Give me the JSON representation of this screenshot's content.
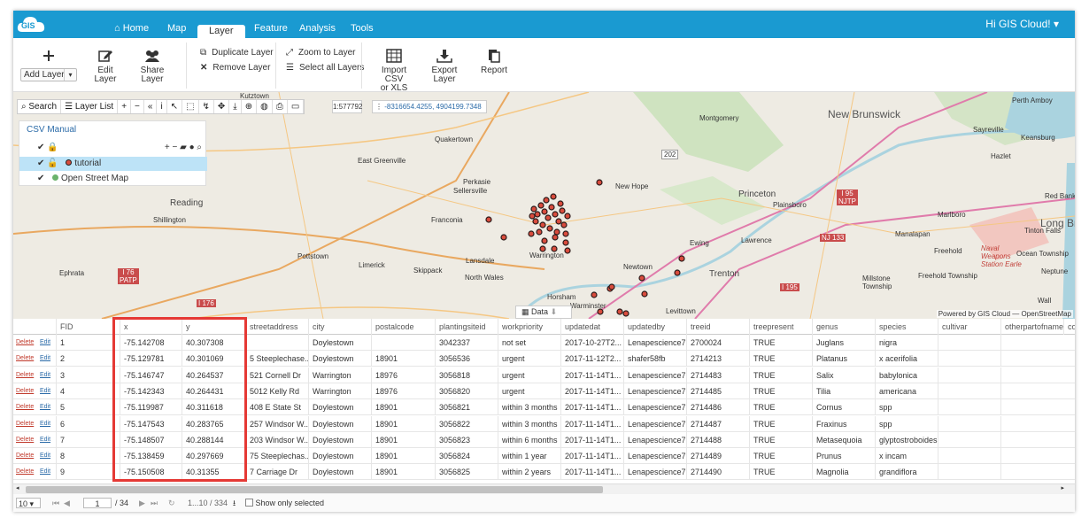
{
  "topnav": {
    "logo_text": "GIS",
    "tabs": [
      "Home",
      "Map",
      "Layer",
      "Feature",
      "Analysis",
      "Tools"
    ],
    "active_tab": "Layer",
    "user": "Hi GIS Cloud! ▾"
  },
  "ribbon": {
    "add_layer": "Add Layer",
    "edit_layer": "Edit Layer",
    "share_layer": "Share Layer",
    "duplicate_layer": "Duplicate Layer",
    "remove_layer": "Remove Layer",
    "zoom_to_layer": "Zoom to Layer",
    "select_all_layers": "Select all Layers",
    "import_csv_1": "Import CSV",
    "import_csv_2": "or XLS",
    "export_layer_1": "Export",
    "export_layer_2": "Layer",
    "report": "Report"
  },
  "map": {
    "search": "Search",
    "layer_list": "Layer List",
    "scale": "1:577792",
    "coords": "-8316654.4255, 4904199.7348",
    "panel_title": "CSV Manual",
    "layers": [
      "tutorial",
      "Open Street Map"
    ],
    "data_tab": "Data",
    "attribution": "Powered by GIS Cloud — OpenStreetMap",
    "labels": {
      "kutztown": "Kutztown",
      "montgomery": "Montgomery",
      "new_brunswick": "New Brunswick",
      "perth_amboy": "Perth Amboy",
      "sayreville": "Sayreville",
      "quakertown": "Quakertown",
      "east_greenville": "East Greenville",
      "keansburg": "Keansburg",
      "perkasie": "Perkasie",
      "sellersville": "Sellersville",
      "new_hope": "New Hope",
      "hazlet": "Hazlet",
      "reading": "Reading",
      "shillington": "Shillington",
      "franconia": "Franconia",
      "princeton": "Princeton",
      "plainsboro": "Plainsboro",
      "red_bank": "Red Bank",
      "long_branch": "Long Branch",
      "marlboro": "Marlboro",
      "manalapan": "Manalapan",
      "tinton_falls": "Tinton Falls",
      "ewing": "Ewing",
      "lawrence": "Lawrence",
      "freehold": "Freehold",
      "lansdale": "Lansdale",
      "warrington": "Warrington",
      "pottstown": "Pottstown",
      "limerick": "Limerick",
      "skippack": "Skippack",
      "north_wales": "North Wales",
      "newtown": "Newtown",
      "trenton": "Trenton",
      "ocean_township": "Ocean Township",
      "neptune": "Neptune",
      "freehold_township": "Freehold Township",
      "millstone": "Millstone Township",
      "naval": "Naval Weapons Station Earle",
      "ephrata": "Ephrata",
      "horsham": "Horsham",
      "warminster": "Warminster",
      "levittown": "Levittown",
      "wall": "Wall",
      "i202": "202",
      "i95": "I 95",
      "njtp": "NJTP",
      "nj133": "NJ 133",
      "i176a": "I 76",
      "patp": "PATP",
      "i176b": "I 176",
      "i195": "I 195"
    }
  },
  "table": {
    "columns": [
      "FID",
      "x",
      "y",
      "streetaddress",
      "city",
      "postalcode",
      "plantingsiteid",
      "workpriority",
      "updatedat",
      "updatedby",
      "treeid",
      "treepresent",
      "genus",
      "species",
      "cultivar",
      "otherpartofname",
      "co"
    ],
    "delete_label": "Delete",
    "edit_label": "Edit",
    "rows": [
      [
        "1",
        "-75.142708",
        "40.307308",
        "",
        "Doylestown",
        "",
        "3042337",
        "not set",
        "2017-10-27T2...",
        "Lenapescience7",
        "2700024",
        "TRUE",
        "Juglans",
        "nigra",
        "",
        ""
      ],
      [
        "2",
        "-75.129781",
        "40.301069",
        "5 Steeplechase...",
        "Doylestown",
        "18901",
        "3056536",
        "urgent",
        "2017-11-12T2...",
        "shafer58fb",
        "2714213",
        "TRUE",
        "Platanus",
        "x acerifolia",
        "",
        ""
      ],
      [
        "3",
        "-75.146747",
        "40.264537",
        "521 Cornell Dr",
        "Warrington",
        "18976",
        "3056818",
        "urgent",
        "2017-11-14T1...",
        "Lenapescience7",
        "2714483",
        "TRUE",
        "Salix",
        "babylonica",
        "",
        ""
      ],
      [
        "4",
        "-75.142343",
        "40.264431",
        "5012 Kelly Rd",
        "Warrington",
        "18976",
        "3056820",
        "urgent",
        "2017-11-14T1...",
        "Lenapescience7",
        "2714485",
        "TRUE",
        "Tilia",
        "americana",
        "",
        ""
      ],
      [
        "5",
        "-75.119987",
        "40.311618",
        "408 E State St",
        "Doylestown",
        "18901",
        "3056821",
        "within 3 months",
        "2017-11-14T1...",
        "Lenapescience7",
        "2714486",
        "TRUE",
        "Cornus",
        "spp",
        "",
        ""
      ],
      [
        "6",
        "-75.147543",
        "40.283765",
        "257 Windsor W...",
        "Doylestown",
        "18901",
        "3056822",
        "within 3 months",
        "2017-11-14T1...",
        "Lenapescience7",
        "2714487",
        "TRUE",
        "Fraxinus",
        "spp",
        "",
        ""
      ],
      [
        "7",
        "-75.148507",
        "40.288144",
        "203 Windsor W...",
        "Doylestown",
        "18901",
        "3056823",
        "within 6 months",
        "2017-11-14T1...",
        "Lenapescience7",
        "2714488",
        "TRUE",
        "Metasequoia",
        "glyptostroboides",
        "",
        ""
      ],
      [
        "8",
        "-75.138459",
        "40.297669",
        "75 Steeplechas...",
        "Doylestown",
        "18901",
        "3056824",
        "within 1 year",
        "2017-11-14T1...",
        "Lenapescience7",
        "2714489",
        "TRUE",
        "Prunus",
        "x incam",
        "",
        ""
      ],
      [
        "9",
        "-75.150508",
        "40.31355",
        "7 Carriage Dr",
        "Doylestown",
        "18901",
        "3056825",
        "within 2 years",
        "2017-11-14T1...",
        "Lenapescience7",
        "2714490",
        "TRUE",
        "Magnolia",
        "grandiflora",
        "",
        ""
      ]
    ]
  },
  "pager": {
    "page_size": "10 ▾",
    "page": "1",
    "of": "/ 34",
    "range": "1...10 / 334",
    "show_selected": "Show only selected"
  }
}
